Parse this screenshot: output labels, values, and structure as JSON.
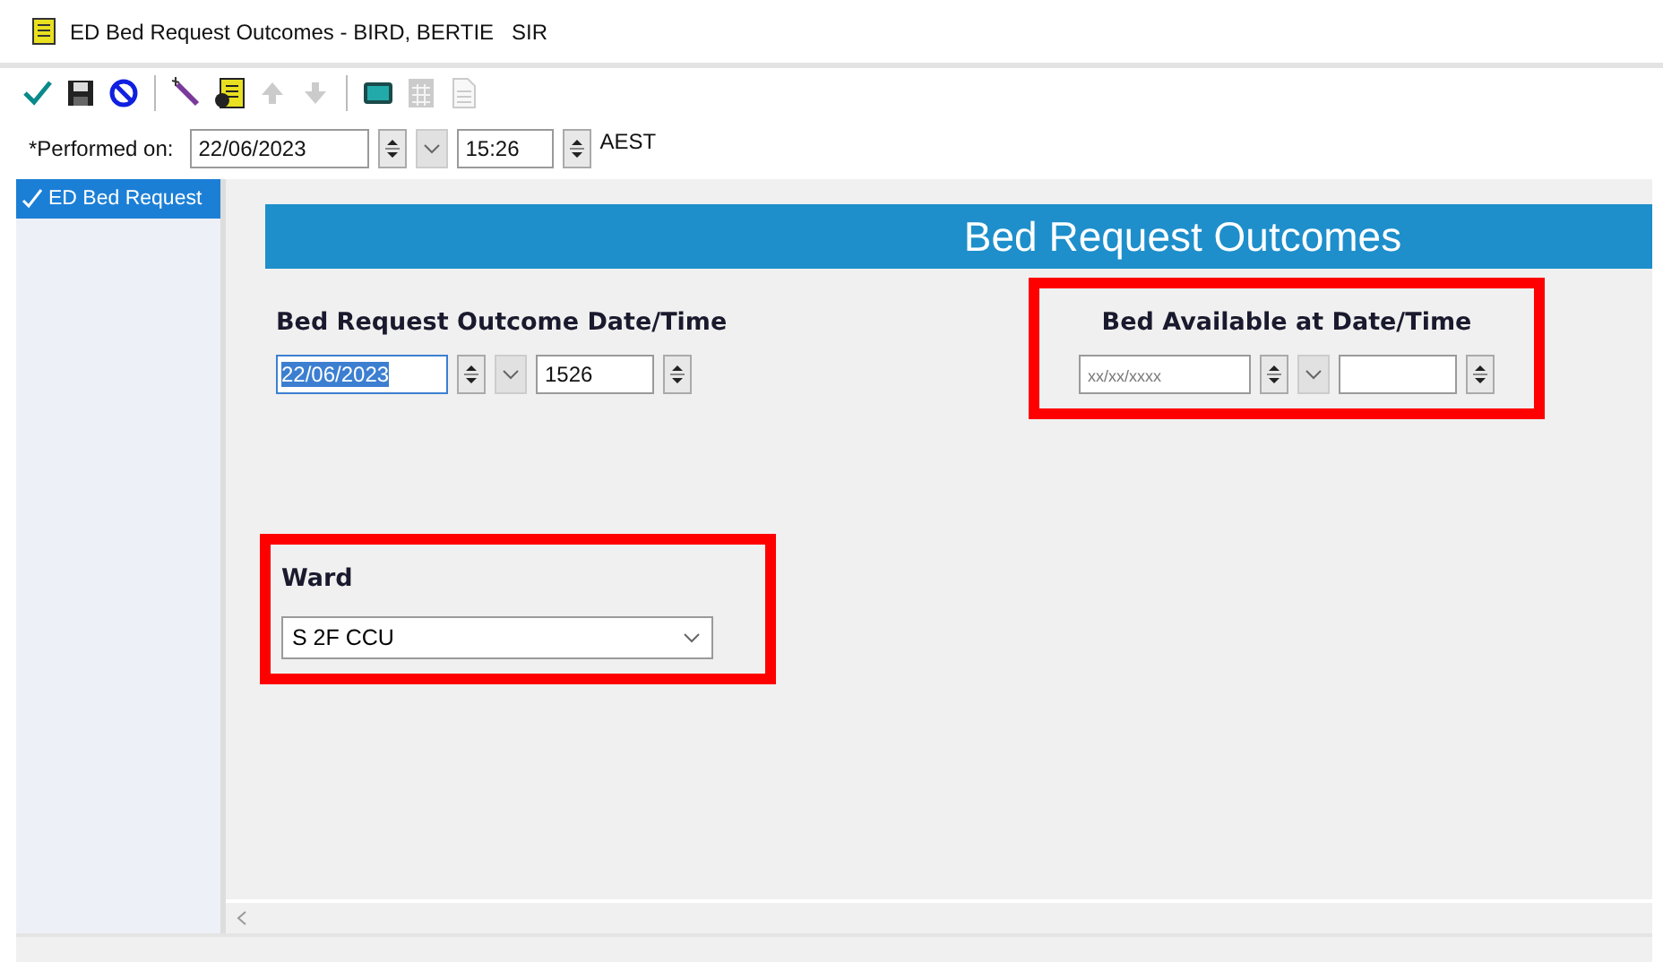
{
  "window": {
    "title": "ED Bed Request Outcomes - BIRD, BERTIE   SIR"
  },
  "toolbar": [
    {
      "kind": "check",
      "disabled": false
    },
    {
      "kind": "save",
      "disabled": false
    },
    {
      "kind": "cancel",
      "disabled": false
    },
    {
      "kind": "separator"
    },
    {
      "kind": "wand",
      "disabled": false
    },
    {
      "kind": "form",
      "disabled": false
    },
    {
      "kind": "up",
      "disabled": true
    },
    {
      "kind": "down",
      "disabled": true
    },
    {
      "kind": "separator"
    },
    {
      "kind": "monitor",
      "disabled": false
    },
    {
      "kind": "calc",
      "disabled": true
    },
    {
      "kind": "doc",
      "disabled": true
    }
  ],
  "performed_on": {
    "label": "*Performed on:",
    "date": "22/06/2023",
    "time": "15:26",
    "timezone": "AEST"
  },
  "sidebar": {
    "items": [
      {
        "label": "ED Bed Request",
        "selected": true
      }
    ]
  },
  "banner": {
    "title": "Bed Request Outcomes"
  },
  "sections": [
    {
      "label": "Bed Request Outcome Date/Time",
      "highlighted": false,
      "date": {
        "value": "22/06/2023",
        "selected": true
      },
      "time": {
        "value": "1526"
      }
    },
    {
      "label": "Bed Available at Date/Time",
      "highlighted": true,
      "date": {
        "placeholder": "xx/xx/xxxx",
        "selected": false
      }
    }
  ],
  "ward": {
    "label": "Ward",
    "value": "S 2F CCU",
    "highlighted": true
  }
}
